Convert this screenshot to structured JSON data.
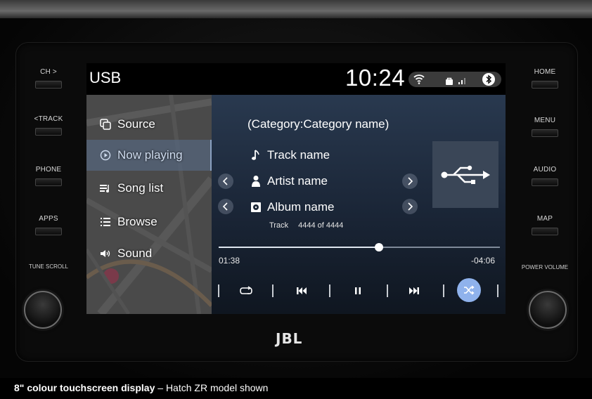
{
  "left_buttons": [
    {
      "label": "CH >"
    },
    {
      "label": "<TRACK"
    },
    {
      "label": "PHONE"
    },
    {
      "label": "APPS"
    }
  ],
  "left_knob_label": "TUNE SCROLL",
  "right_buttons": [
    {
      "label": "HOME"
    },
    {
      "label": "MENU"
    },
    {
      "label": "AUDIO"
    },
    {
      "label": "MAP"
    }
  ],
  "right_knob_label": "POWER VOLUME",
  "status": {
    "title": "USB",
    "time": "10:24"
  },
  "menu": {
    "items": [
      {
        "label": "Source",
        "icon": "source-icon"
      },
      {
        "label": "Now playing",
        "icon": "play-circle-icon",
        "active": true
      },
      {
        "label": "Song list",
        "icon": "song-list-icon"
      },
      {
        "label": "Browse",
        "icon": "browse-list-icon"
      },
      {
        "label": "Sound",
        "icon": "speaker-icon"
      }
    ]
  },
  "player": {
    "category": "(Category:Category name)",
    "track_name": "Track name",
    "artist_name": "Artist name",
    "album_name": "Album name",
    "track_label": "Track",
    "track_count": "4444 of 4444",
    "elapsed": "01:38",
    "remaining": "-04:06",
    "progress": 0.57
  },
  "controls": [
    "repeat-icon",
    "previous-track-icon",
    "pause-icon",
    "next-track-icon",
    "shuffle-icon"
  ],
  "brand": "JBL",
  "caption": {
    "bold": "8\" colour touchscreen display",
    "rest": " – Hatch ZR model shown"
  },
  "colors": {
    "active_menu": "#566882",
    "shuffle_active": "#8fb2ec"
  }
}
